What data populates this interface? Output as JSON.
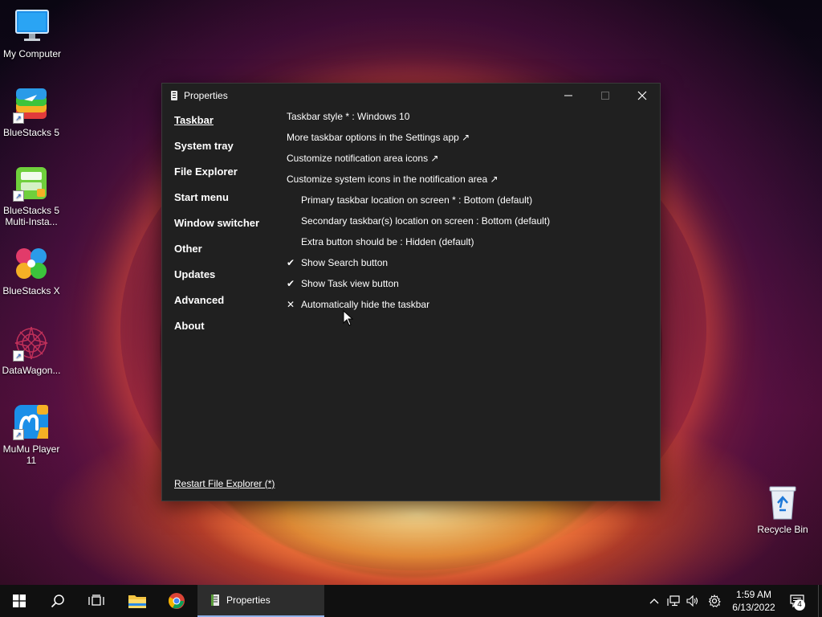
{
  "desktop": {
    "icons": [
      {
        "label": "My Computer"
      },
      {
        "label": "BlueStacks 5"
      },
      {
        "label": "BlueStacks 5 Multi-Insta..."
      },
      {
        "label": "BlueStacks X"
      },
      {
        "label": "DataWagon..."
      },
      {
        "label": "MuMu Player 11"
      },
      {
        "label": "Recycle Bin"
      }
    ]
  },
  "window": {
    "title": "Properties",
    "nav": [
      {
        "label": "Taskbar",
        "active": true
      },
      {
        "label": "System tray"
      },
      {
        "label": "File Explorer"
      },
      {
        "label": "Start menu"
      },
      {
        "label": "Window switcher"
      },
      {
        "label": "Other"
      },
      {
        "label": "Updates"
      },
      {
        "label": "Advanced"
      },
      {
        "label": "About"
      }
    ],
    "settings": [
      {
        "text": "Taskbar style * : Windows 10"
      },
      {
        "text": "More taskbar options in the Settings app ↗"
      },
      {
        "text": "Customize notification area icons ↗"
      },
      {
        "text": "Customize system icons in the notification area ↗"
      },
      {
        "text": "Primary taskbar location on screen * : Bottom (default)"
      },
      {
        "text": "Secondary taskbar(s) location on screen : Bottom (default)"
      },
      {
        "text": "Extra button should be : Hidden (default)"
      },
      {
        "mark": "✔",
        "text": "Show Search button"
      },
      {
        "mark": "✔",
        "text": "Show Task view button"
      },
      {
        "mark": "✕",
        "text": "Automatically hide the taskbar"
      }
    ],
    "restart_link": "Restart File Explorer (*)"
  },
  "taskbar": {
    "active_app": "Properties",
    "clock_time": "1:59 AM",
    "clock_date": "6/13/2022",
    "notification_count": "4",
    "start_icon": "windows-logo-icon",
    "search_icon": "search-icon",
    "taskview_icon": "task-view-icon"
  },
  "colors": {
    "window_bg": "#202020",
    "taskbar_bg": "#101010",
    "active_app_bg": "#2d2d2d",
    "accent": "#8fb0e8"
  }
}
